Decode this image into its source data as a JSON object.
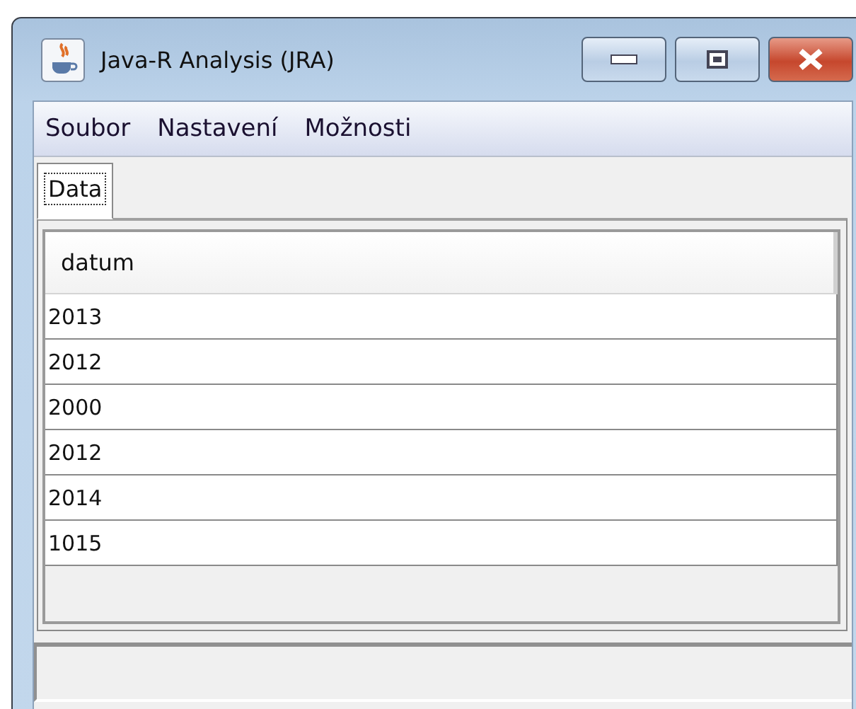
{
  "window": {
    "title": "Java-R Analysis (JRA)"
  },
  "menu": [
    "Soubor",
    "Nastavení",
    "Možnosti"
  ],
  "tabs": [
    {
      "label": "Data",
      "selected": true
    }
  ],
  "table": {
    "columns": [
      "datum"
    ],
    "rows": [
      [
        "2013"
      ],
      [
        "2012"
      ],
      [
        "2000"
      ],
      [
        "2012"
      ],
      [
        "2014"
      ],
      [
        "1015"
      ]
    ]
  }
}
